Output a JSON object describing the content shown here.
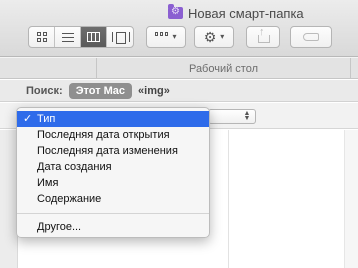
{
  "window": {
    "title": "Новая смарт-папка"
  },
  "toolbar": {
    "view_buttons": [
      "icon-view",
      "list-view",
      "column-view",
      "cover-flow-view"
    ],
    "active_view": "column-view",
    "share_disabled": true,
    "tags_disabled": true
  },
  "path": {
    "current": "Рабочий стол"
  },
  "search": {
    "label": "Поиск:",
    "scope_active": "Этот Mac",
    "scope_query": "«img»"
  },
  "menu": {
    "items": [
      {
        "label": "Тип",
        "checked": true
      },
      {
        "label": "Последняя дата открытия"
      },
      {
        "label": "Последняя дата изменения"
      },
      {
        "label": "Дата создания"
      },
      {
        "label": "Имя"
      },
      {
        "label": "Содержание"
      }
    ],
    "other_label": "Другое...",
    "check_glyph": "✓"
  },
  "colors": {
    "selection": "#2e6bea",
    "folder": "#8b5fd1"
  }
}
